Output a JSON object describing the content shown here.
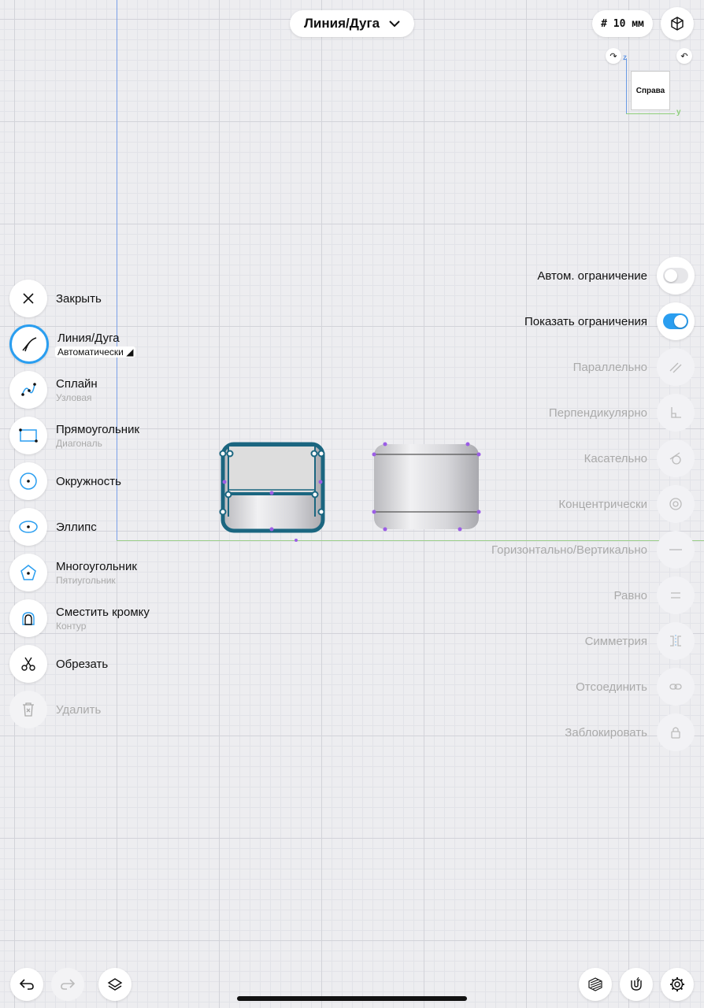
{
  "header": {
    "mode_label": "Линия/Дуга",
    "grid_size": "# 10 мм"
  },
  "view_cube": {
    "face_label": "Справа",
    "axis_z": "z",
    "axis_y": "y"
  },
  "tools": [
    {
      "label": "Закрыть",
      "sub": ""
    },
    {
      "label": "Линия/Дуга",
      "sub": "Автоматически ◢"
    },
    {
      "label": "Сплайн",
      "sub": "Узловая"
    },
    {
      "label": "Прямоугольник",
      "sub": "Диагональ"
    },
    {
      "label": "Окружность",
      "sub": ""
    },
    {
      "label": "Эллипс",
      "sub": ""
    },
    {
      "label": "Многоугольник",
      "sub": "Пятиугольник"
    },
    {
      "label": "Сместить кромку",
      "sub": "Контур"
    },
    {
      "label": "Обрезать",
      "sub": ""
    },
    {
      "label": "Удалить",
      "sub": ""
    }
  ],
  "constraints": [
    {
      "label": "Автом. ограничение",
      "toggle": "off"
    },
    {
      "label": "Показать ограничения",
      "toggle": "on"
    },
    {
      "label": "Параллельно"
    },
    {
      "label": "Перпендикулярно"
    },
    {
      "label": "Касательно"
    },
    {
      "label": "Концентрически"
    },
    {
      "label": "Горизонтально/Вертикально"
    },
    {
      "label": "Равно"
    },
    {
      "label": "Симметрия"
    },
    {
      "label": "Отсоединить"
    },
    {
      "label": "Заблокировать"
    }
  ],
  "colors": {
    "accent": "#2a9ef0",
    "sketch": "#1b6680",
    "point": "#9b5de5"
  }
}
